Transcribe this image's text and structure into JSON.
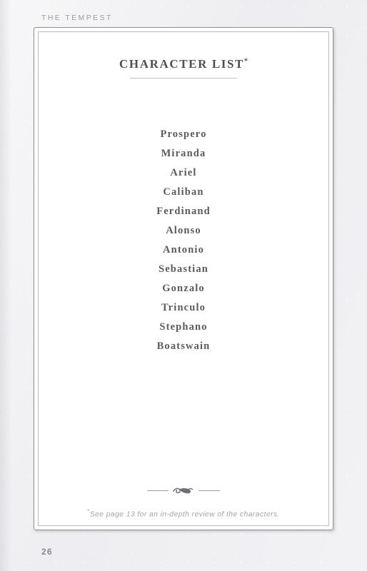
{
  "header": {
    "running_title": "THE TEMPEST"
  },
  "frame": {
    "title": "CHARACTER LIST",
    "title_footnote_mark": "*"
  },
  "characters": [
    {
      "name": "Prospero"
    },
    {
      "name": "Miranda"
    },
    {
      "name": "Ariel"
    },
    {
      "name": "Caliban"
    },
    {
      "name": "Ferdinand"
    },
    {
      "name": "Alonso"
    },
    {
      "name": "Antonio"
    },
    {
      "name": "Sebastian"
    },
    {
      "name": "Gonzalo"
    },
    {
      "name": "Trinculo"
    },
    {
      "name": "Stephano"
    },
    {
      "name": "Boatswain"
    }
  ],
  "ornament": {
    "icon": "flourish-ornament-icon"
  },
  "footnote": {
    "mark": "*",
    "text": "See page 13 for an in-depth review of the characters."
  },
  "folio": {
    "page_number": "26"
  },
  "colors": {
    "page_background": "#eeeef1",
    "sheet": "#ffffff",
    "border_outer": "#8e8e92",
    "border_inner": "#bcbcc0",
    "title_text": "#4f4f55",
    "name_text": "#5a5a60",
    "header_text": "#9b9ba3",
    "footnote_text": "#a3a3ab",
    "folio_text": "#86868e"
  }
}
